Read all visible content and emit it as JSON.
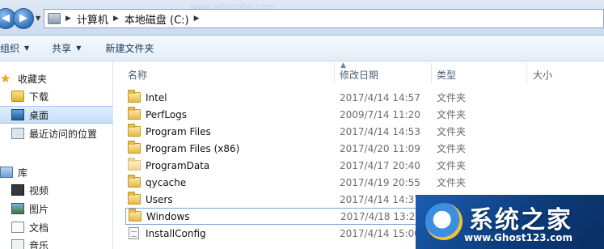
{
  "address": {
    "crumbs": [
      "计算机",
      "本地磁盘 (C:)"
    ],
    "bg_watermark": "www.xitonghe.com"
  },
  "toolbar": {
    "organize": "组织",
    "share": "共享",
    "new_folder": "新建文件夹"
  },
  "nav": {
    "favorites": "收藏夹",
    "downloads": "下载",
    "desktop": "桌面",
    "recent": "最近访问的位置",
    "libraries": "库",
    "videos": "视频",
    "pictures": "图片",
    "documents": "文档",
    "music": "音乐"
  },
  "columns": {
    "name": "名称",
    "date": "修改日期",
    "type": "类型",
    "size": "大小"
  },
  "files": [
    {
      "name": "Intel",
      "date": "2017/4/14 14:57",
      "type": "文件夹",
      "icon": "folder"
    },
    {
      "name": "PerfLogs",
      "date": "2009/7/14 11:20",
      "type": "文件夹",
      "icon": "folder"
    },
    {
      "name": "Program Files",
      "date": "2017/4/14 14:53",
      "type": "文件夹",
      "icon": "folder"
    },
    {
      "name": "Program Files (x86)",
      "date": "2017/4/20 11:09",
      "type": "文件夹",
      "icon": "folder"
    },
    {
      "name": "ProgramData",
      "date": "2017/4/17 20:40",
      "type": "文件夹",
      "icon": "folder"
    },
    {
      "name": "qycache",
      "date": "2017/4/19 20:55",
      "type": "文件夹",
      "icon": "folder"
    },
    {
      "name": "Users",
      "date": "2017/4/14 14:37",
      "type": "文件夹",
      "icon": "folder"
    },
    {
      "name": "Windows",
      "date": "2017/4/18 13:20",
      "type": "文件夹",
      "icon": "folder"
    },
    {
      "name": "InstallConfig",
      "date": "2017/4/14 15:00",
      "type": "",
      "icon": "file"
    }
  ],
  "watermark": {
    "title": "系统之家",
    "url": "www.Ghost123.com"
  },
  "colors": {
    "accent": "#1a5fb4",
    "selection_border": "#7da2ce"
  }
}
